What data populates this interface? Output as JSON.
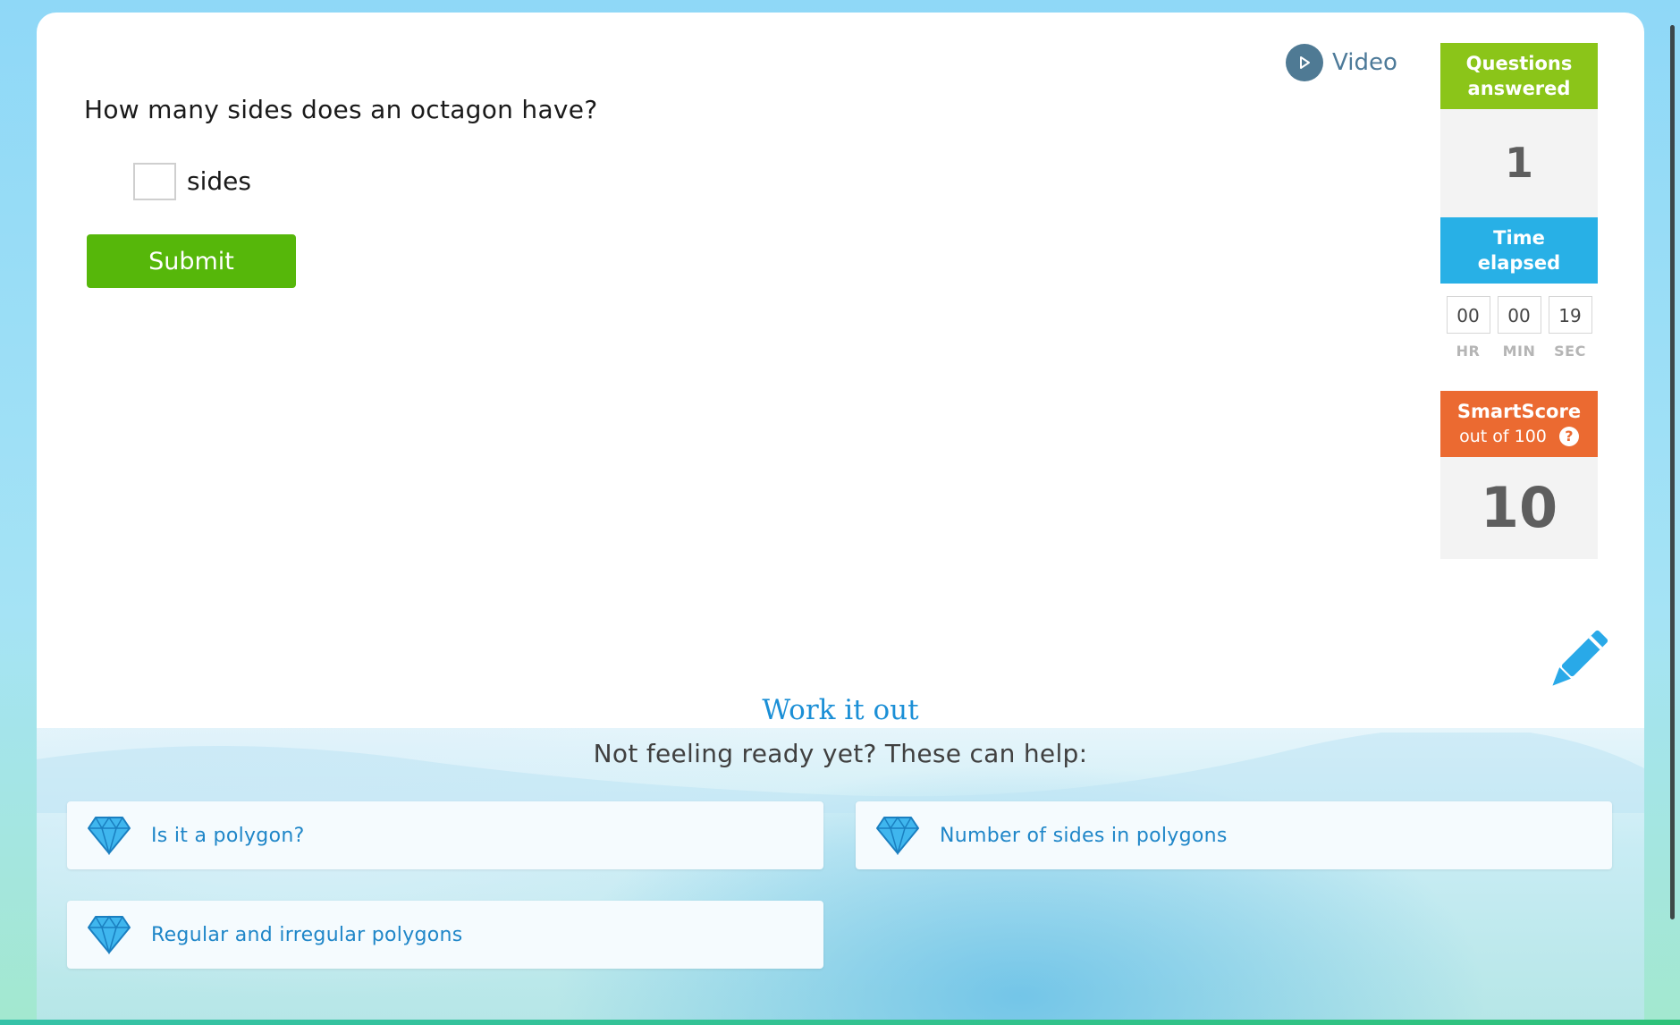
{
  "question": {
    "text": "How many sides does an octagon have?",
    "answer_value": "",
    "unit": "sides",
    "submit_label": "Submit"
  },
  "video": {
    "label": "Video"
  },
  "stats": {
    "questions_answered": {
      "label_line1": "Questions",
      "label_line2": "answered",
      "value": "1"
    },
    "time_elapsed": {
      "label_line1": "Time",
      "label_line2": "elapsed",
      "hr": "00",
      "min": "00",
      "sec": "19",
      "hr_label": "HR",
      "min_label": "MIN",
      "sec_label": "SEC"
    },
    "smartscore": {
      "label": "SmartScore",
      "sublabel": "out of 100",
      "help_glyph": "?",
      "value": "10"
    }
  },
  "work_it_out": {
    "title": "Work it out",
    "subtitle": "Not feeling ready yet? These can help:",
    "skills": [
      {
        "label": "Is it a polygon?"
      },
      {
        "label": "Number of sides in polygons"
      },
      {
        "label": "Regular and irregular polygons"
      }
    ]
  },
  "colors": {
    "submit": "#56b70a",
    "questions_answered": "#8bc519",
    "time_elapsed": "#28b0e6",
    "smartscore": "#eb6a31",
    "link": "#1f86c8"
  }
}
